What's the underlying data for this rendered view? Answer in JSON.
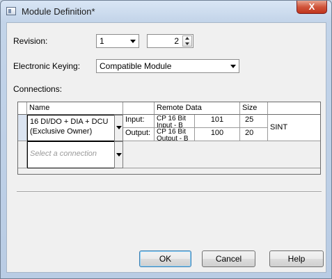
{
  "window": {
    "title": "Module Definition*",
    "close_glyph": "X"
  },
  "revision": {
    "label": "Revision:",
    "major": "1",
    "minor": "2"
  },
  "keying": {
    "label": "Electronic Keying:",
    "value": "Compatible Module"
  },
  "connections": {
    "label": "Connections:",
    "headers": {
      "name": "Name",
      "remote": "Remote Data",
      "size": "Size"
    },
    "row": {
      "name_line1": "16 DI/DO + DIA + DCU",
      "name_line2": "(Exclusive Owner)",
      "input_label": "Input:",
      "output_label": "Output:",
      "input_remote": "CP 16 Bit",
      "input_remote_sub": "Input - B",
      "output_remote": "CP 16 Bit",
      "output_remote_sub": "Output - B",
      "input_instance": "101",
      "output_instance": "100",
      "input_size": "25",
      "output_size": "20",
      "type": "SINT"
    },
    "placeholder": "Select a connection"
  },
  "buttons": {
    "ok": "OK",
    "cancel": "Cancel",
    "help": "Help"
  }
}
